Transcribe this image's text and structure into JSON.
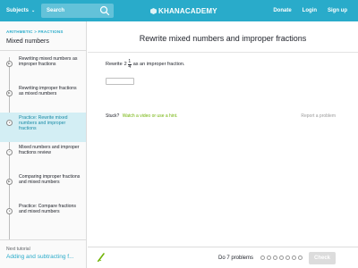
{
  "nav": {
    "subjects_label": "Subjects",
    "search_placeholder": "Search",
    "logo_text": "KHANACADEMY",
    "links": [
      "Donate",
      "Login",
      "Sign up"
    ],
    "bar_color": "#29abca"
  },
  "sidebar": {
    "breadcrumb": "ARITHMETIC  >  FRACTIONS",
    "title": "Mixed numbers",
    "items": [
      {
        "label": "Rewriting mixed numbers as improper fractions",
        "icon": "video-icon"
      },
      {
        "label": "Rewriting improper fractions as mixed numbers",
        "icon": "video-icon"
      },
      {
        "label": "Practice: Rewrite mixed numbers and improper fractions",
        "icon": "exercise-icon",
        "active": true
      },
      {
        "label": "Mixed numbers and improper fractions review",
        "icon": "article-icon"
      },
      {
        "label": "Comparing improper fractions and mixed numbers",
        "icon": "video-icon"
      },
      {
        "label": "Practice: Compare fractions and mixed numbers",
        "icon": "exercise-icon"
      }
    ],
    "next_tutorial_label": "Next tutorial",
    "next_tutorial_link": "Adding and subtracting f..."
  },
  "main": {
    "title": "Rewrite mixed numbers and improper fractions",
    "prompt_before": "Rewrite",
    "whole": "2",
    "numerator": "1",
    "denominator": "4",
    "prompt_after": "as an improper fraction.",
    "answer_value": "",
    "stuck_label": "Stuck?",
    "stuck_link": "Watch a video or use a hint.",
    "report_label": "Report a problem"
  },
  "footer": {
    "do_label": "Do 7 problems",
    "check_label": "Check",
    "accent_green": "#71b307"
  }
}
